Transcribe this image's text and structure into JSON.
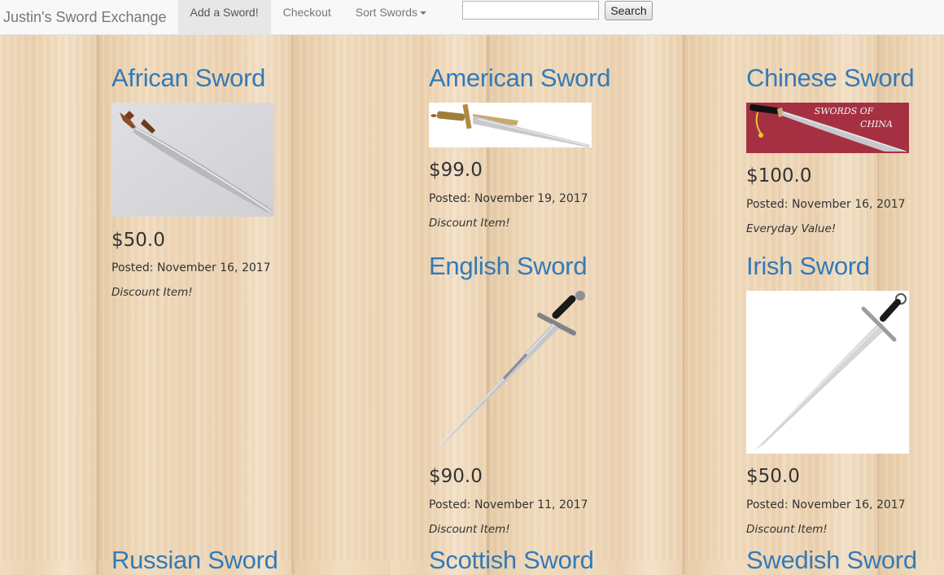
{
  "navbar": {
    "brand": "Justin's Sword Exchange",
    "items": [
      {
        "label": "Add a Sword!",
        "active": true
      },
      {
        "label": "Checkout",
        "active": false
      },
      {
        "label": "Sort Swords",
        "active": false,
        "dropdown": true
      }
    ],
    "search": {
      "value": "",
      "placeholder": "",
      "button_label": "Search"
    }
  },
  "colors": {
    "link": "#337ab7",
    "navbar_bg": "#f8f8f8",
    "wood": "#ecd2b0"
  },
  "swords": [
    {
      "name": "African Sword",
      "price": "$50.0",
      "posted": "Posted: November 16, 2017",
      "tag": "Discount Item!",
      "image": "saber-icon"
    },
    {
      "name": "American Sword",
      "price": "$99.0",
      "posted": "Posted: November 19, 2017",
      "tag": "Discount Item!",
      "image": "ornate-sword-icon"
    },
    {
      "name": "Chinese Sword",
      "price": "$100.0",
      "posted": "Posted: November 16, 2017",
      "tag": "Everyday Value!",
      "image": "dao-sword-icon",
      "image_text_1": "SWORDS OF",
      "image_text_2": "CHINA"
    },
    {
      "name": "English Sword",
      "price": "$90.0",
      "posted": "Posted: November 11, 2017",
      "tag": "Discount Item!",
      "image": "longsword-icon"
    },
    {
      "name": "Irish Sword",
      "price": "$50.0",
      "posted": "Posted: November 16, 2017",
      "tag": "Discount Item!",
      "image": "broadsword-icon"
    },
    {
      "name": "Russian Sword",
      "image": ""
    },
    {
      "name": "Scottish Sword",
      "image": ""
    },
    {
      "name": "Swedish Sword",
      "image": ""
    }
  ]
}
